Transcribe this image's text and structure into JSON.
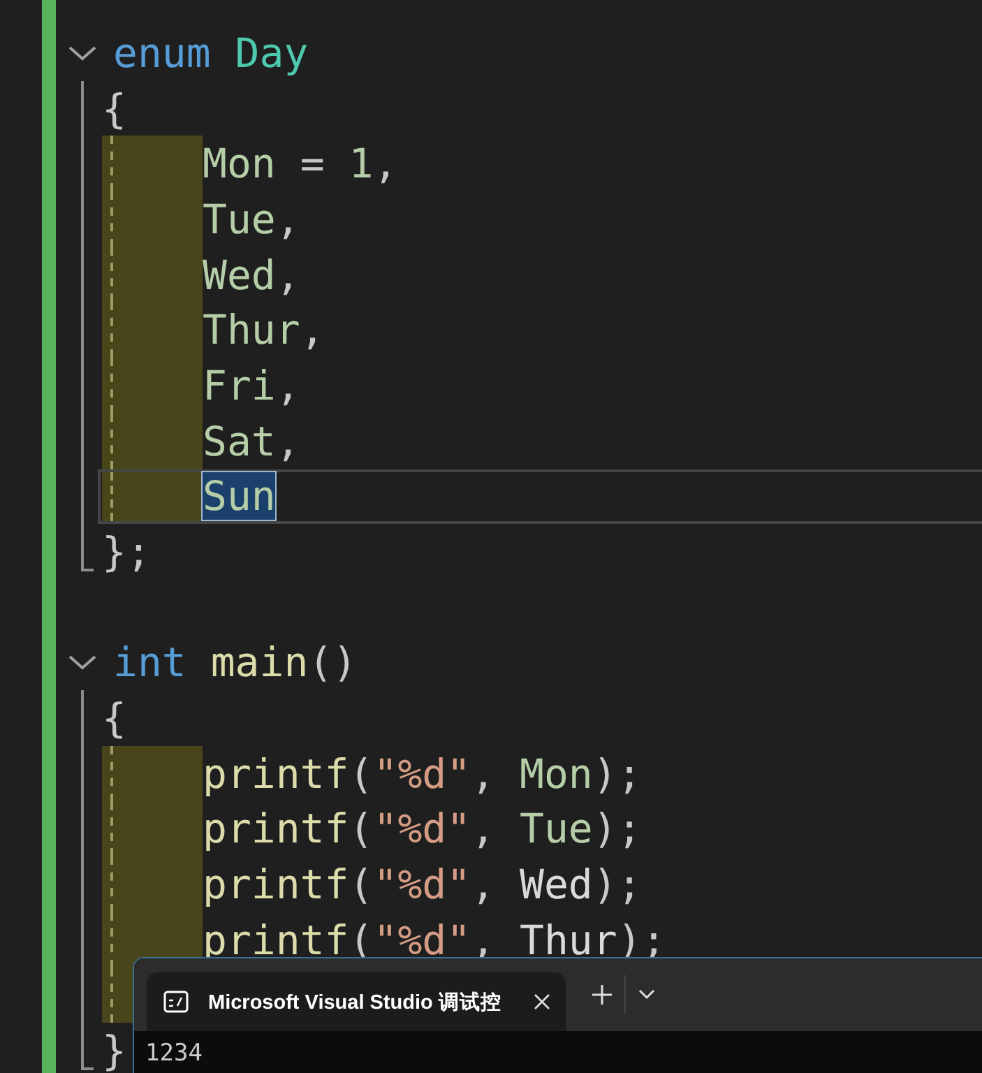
{
  "editor": {
    "blocks": [
      {
        "expanded": true,
        "header": [
          {
            "text": "enum",
            "kind": "keyword"
          },
          {
            "text": "Day",
            "kind": "type"
          }
        ],
        "lines": [
          {
            "indented": false,
            "current": false,
            "tokens": [
              {
                "text": "{",
                "kind": "punct"
              }
            ]
          },
          {
            "indented": true,
            "current": false,
            "tokens": [
              {
                "text": "Mon",
                "kind": "member"
              },
              {
                "text": " = ",
                "kind": "punct"
              },
              {
                "text": "1",
                "kind": "number"
              },
              {
                "text": ",",
                "kind": "punct"
              }
            ]
          },
          {
            "indented": true,
            "current": false,
            "tokens": [
              {
                "text": "Tue",
                "kind": "member"
              },
              {
                "text": ",",
                "kind": "punct"
              }
            ]
          },
          {
            "indented": true,
            "current": false,
            "tokens": [
              {
                "text": "Wed",
                "kind": "member"
              },
              {
                "text": ",",
                "kind": "punct"
              }
            ]
          },
          {
            "indented": true,
            "current": false,
            "tokens": [
              {
                "text": "Thur",
                "kind": "member"
              },
              {
                "text": ",",
                "kind": "punct"
              }
            ]
          },
          {
            "indented": true,
            "current": false,
            "tokens": [
              {
                "text": "Fri",
                "kind": "member"
              },
              {
                "text": ",",
                "kind": "punct"
              }
            ]
          },
          {
            "indented": true,
            "current": false,
            "tokens": [
              {
                "text": "Sat",
                "kind": "member"
              },
              {
                "text": ",",
                "kind": "punct"
              }
            ]
          },
          {
            "indented": true,
            "current": true,
            "tokens": [
              {
                "text": "Sun",
                "kind": "selection"
              }
            ]
          },
          {
            "indented": false,
            "current": false,
            "tokens": [
              {
                "text": "};",
                "kind": "punct"
              }
            ]
          }
        ]
      },
      {
        "expanded": true,
        "header": [
          {
            "text": "int",
            "kind": "keyword"
          },
          {
            "text": "main",
            "kind": "function"
          },
          {
            "text": "()",
            "kind": "punct"
          }
        ],
        "lines": [
          {
            "indented": false,
            "current": false,
            "tokens": [
              {
                "text": "{",
                "kind": "punct"
              }
            ]
          },
          {
            "indented": true,
            "current": false,
            "tokens": [
              {
                "text": "printf",
                "kind": "function"
              },
              {
                "text": "(",
                "kind": "punct"
              },
              {
                "text": "\"%d\"",
                "kind": "string"
              },
              {
                "text": ", ",
                "kind": "punct"
              },
              {
                "text": "Mon",
                "kind": "member"
              },
              {
                "text": ");",
                "kind": "punct"
              }
            ]
          },
          {
            "indented": true,
            "current": false,
            "tokens": [
              {
                "text": "printf",
                "kind": "function"
              },
              {
                "text": "(",
                "kind": "punct"
              },
              {
                "text": "\"%d\"",
                "kind": "string"
              },
              {
                "text": ", ",
                "kind": "punct"
              },
              {
                "text": "Tue",
                "kind": "member"
              },
              {
                "text": ");",
                "kind": "punct"
              }
            ]
          },
          {
            "indented": true,
            "current": false,
            "tokens": [
              {
                "text": "printf",
                "kind": "function"
              },
              {
                "text": "(",
                "kind": "punct"
              },
              {
                "text": "\"%d\"",
                "kind": "string"
              },
              {
                "text": ", ",
                "kind": "punct"
              },
              {
                "text": "Wed",
                "kind": "plain"
              },
              {
                "text": ");",
                "kind": "punct"
              }
            ]
          },
          {
            "indented": true,
            "current": false,
            "tokens": [
              {
                "text": "printf",
                "kind": "function"
              },
              {
                "text": "(",
                "kind": "punct"
              },
              {
                "text": "\"%d\"",
                "kind": "string"
              },
              {
                "text": ", ",
                "kind": "punct"
              },
              {
                "text": "Thur",
                "kind": "plain"
              },
              {
                "text": ");",
                "kind": "punct"
              }
            ]
          },
          {
            "indented": true,
            "current": false
          },
          {
            "indented": false,
            "current": false,
            "tokens": [
              {
                "text": "}",
                "kind": "punct"
              }
            ]
          }
        ]
      }
    ]
  },
  "terminal": {
    "tab": {
      "title": "Microsoft Visual Studio 调试控",
      "selected": true
    },
    "output": "1234"
  }
}
